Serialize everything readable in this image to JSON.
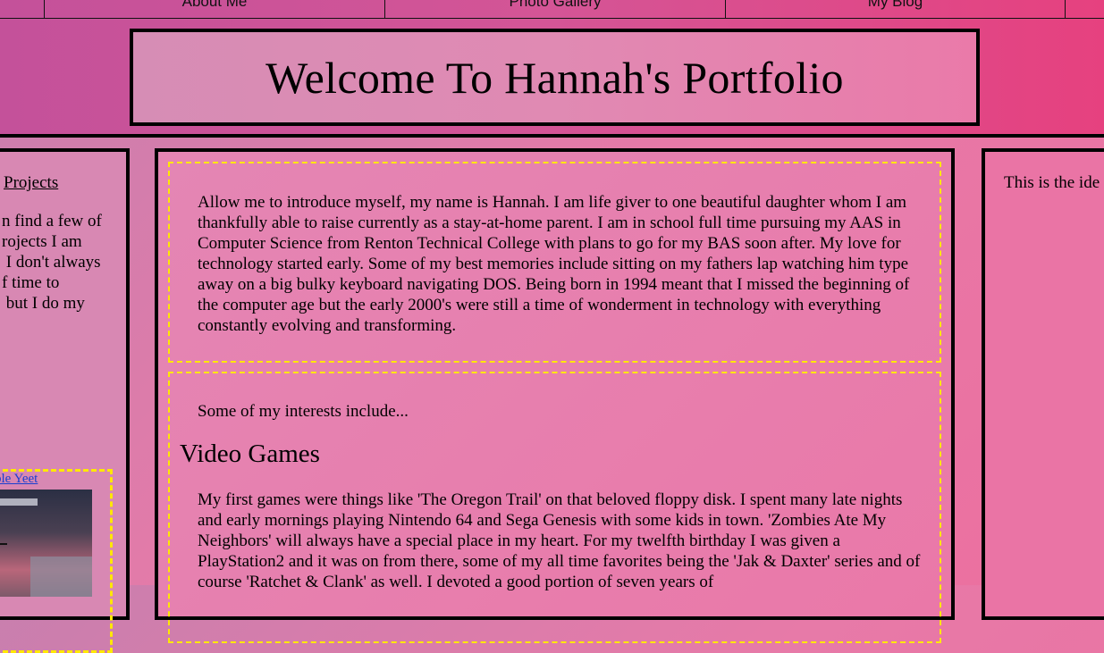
{
  "nav": {
    "items": [
      "About Me",
      "Photo Gallery",
      "My Blog"
    ]
  },
  "header": {
    "title": "Welcome To Hannah's Portfolio"
  },
  "left": {
    "projects_link": "Projects",
    "intro": "n find a few of\nrojects I am\n I don't always\nf time to\n but I do my",
    "project_card": {
      "link": "ble Yeet"
    }
  },
  "main": {
    "about": "Allow me to introduce myself, my name is Hannah. I am life giver to one beautiful daughter whom I am thankfully able to raise currently as a stay-at-home parent. I am in school full time pursuing my AAS in Computer Science from Renton Technical College with plans to go for my BAS soon after. My love for technology started early. Some of my best memories include sitting on my fathers lap watching him type away on a big bulky keyboard navigating DOS. Being born in 1994 meant that I missed the beginning of the computer age but the early 2000's were still a time of wonderment in technology with everything constantly evolving and transforming.",
    "interests_lead": "Some of my interests include...",
    "video_games_heading": "Video Games",
    "video_games_text": "My first games were things like 'The Oregon Trail' on that beloved floppy disk. I spent many late nights and early mornings playing Nintendo 64 and Sega Genesis with some kids in town. 'Zombies Ate My Neighbors' will always have a special place in my heart. For my twelfth birthday I was given a PlayStation2 and it was on from there, some of my all time favorites being the 'Jak & Daxter' series and of course 'Ratchet & Clank' as well. I devoted a good portion of seven years of"
  },
  "right": {
    "text": "This is the ide"
  },
  "colors": {
    "accent_dash": "#ffe800",
    "border": "#000000",
    "link": "#1a3fd0"
  }
}
